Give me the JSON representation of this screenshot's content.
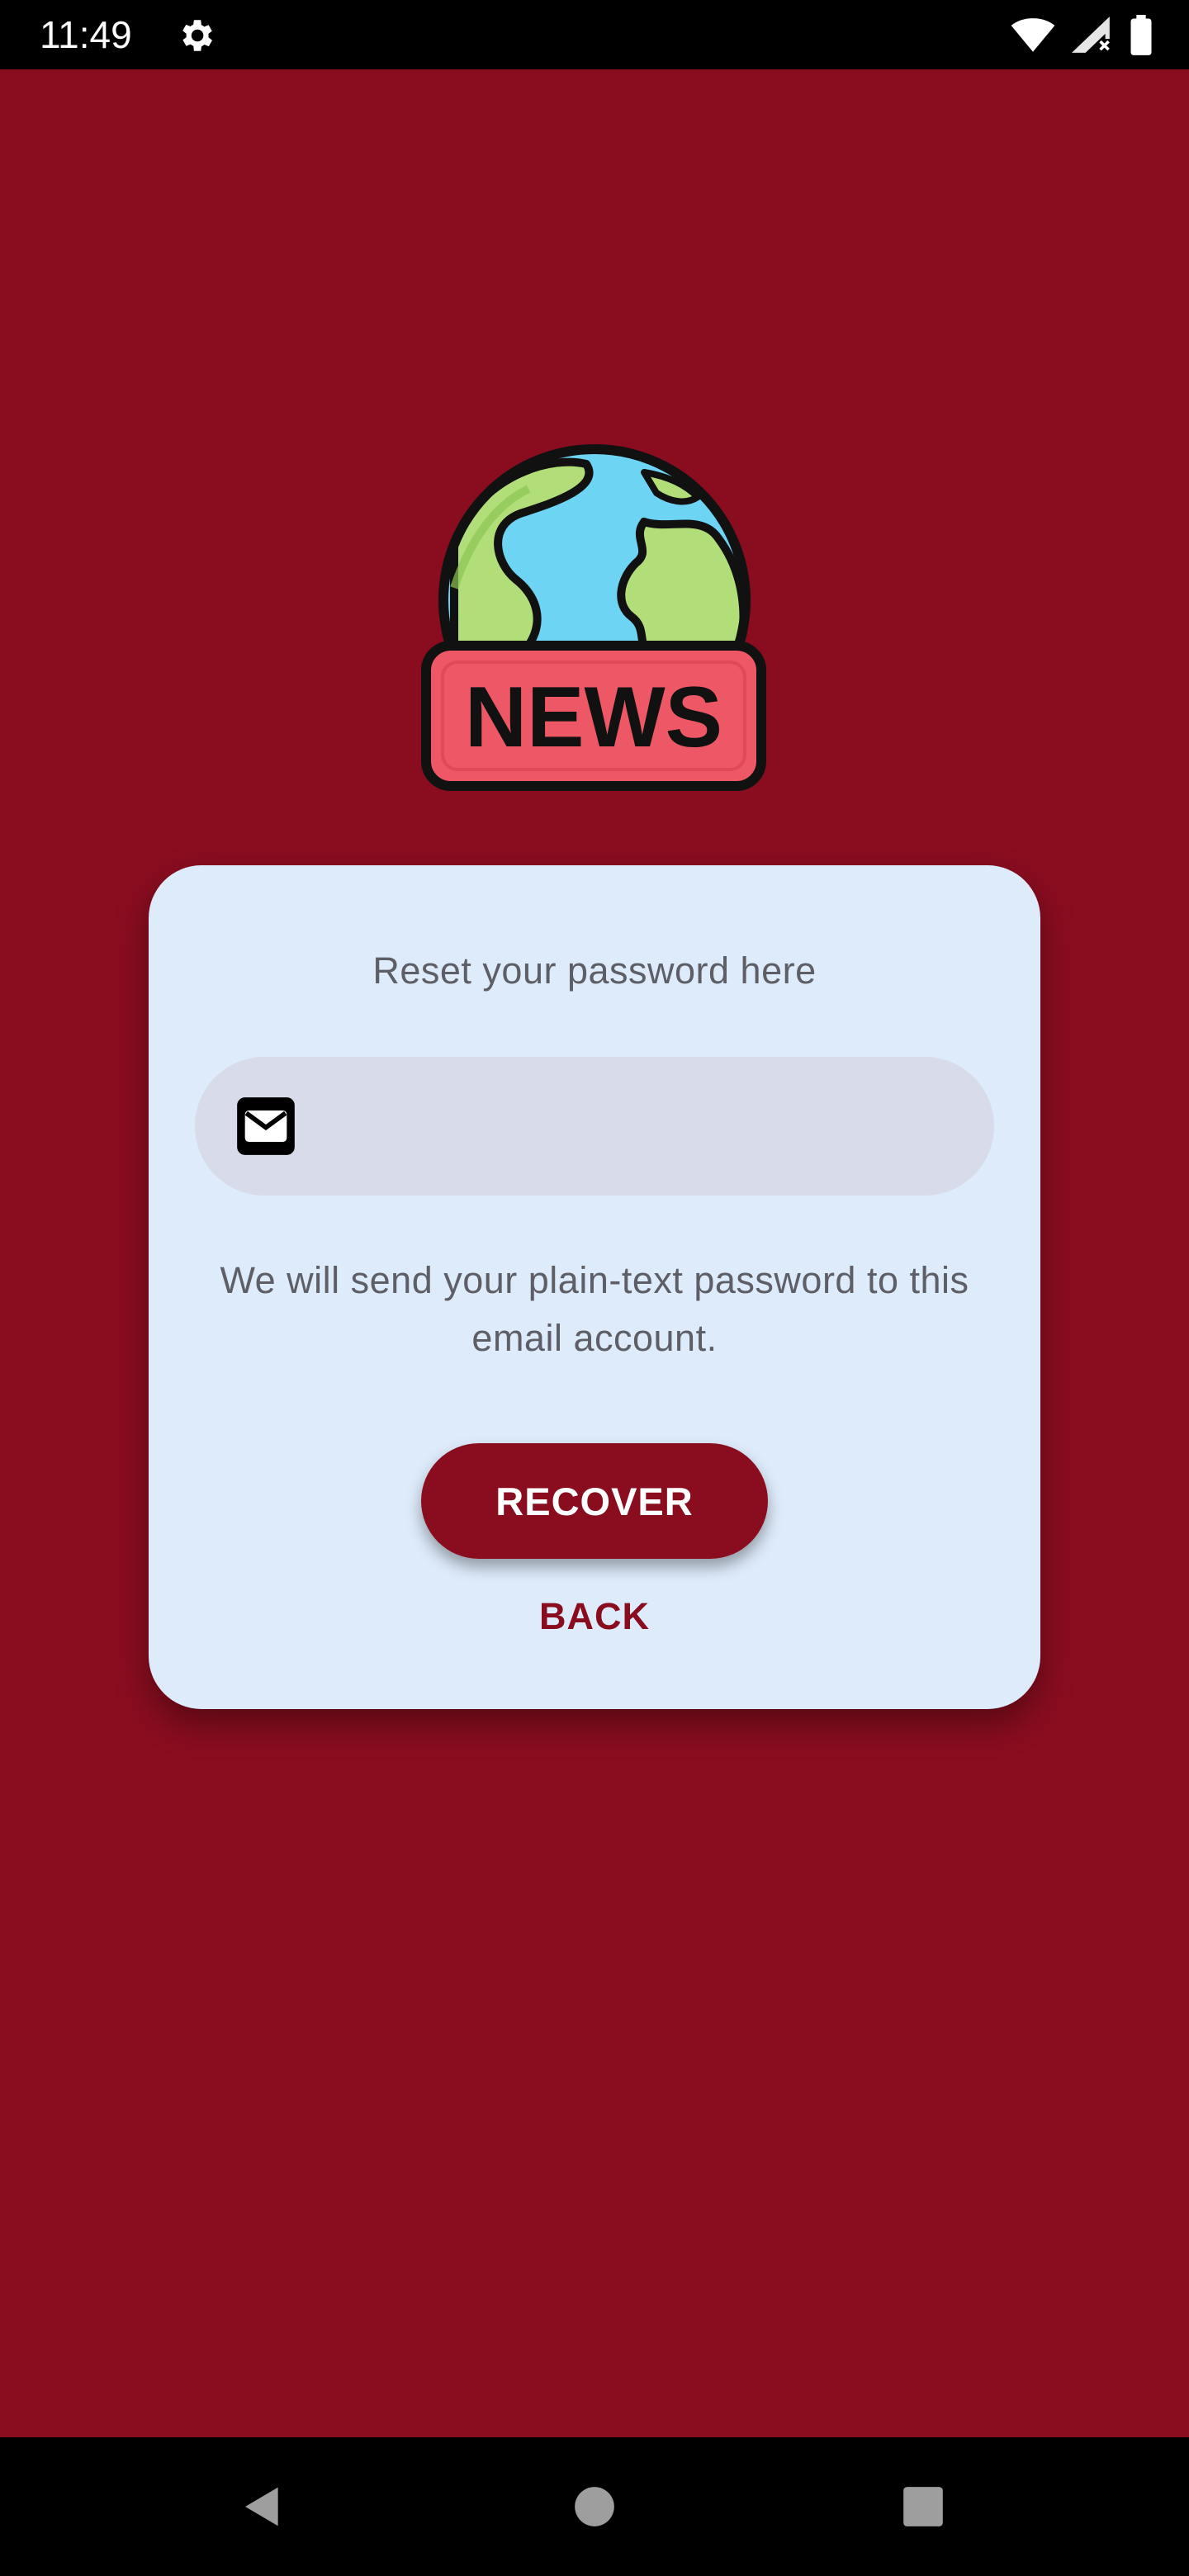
{
  "status_bar": {
    "time": "11:49",
    "icons": [
      "settings-gear-icon",
      "wifi-icon",
      "cellular-signal-icon",
      "battery-icon"
    ]
  },
  "logo": {
    "text": "NEWS",
    "icon": "globe-icon"
  },
  "reset_card": {
    "title": "Reset your password here",
    "email_field": {
      "icon": "email-icon",
      "value": "",
      "placeholder": ""
    },
    "note": "We will send your plain-text password to this email account.",
    "recover_label": "RECOVER",
    "back_label": "BACK"
  },
  "nav_bar": {
    "icons": [
      "back-triangle-icon",
      "home-circle-icon",
      "recents-square-icon"
    ]
  },
  "colors": {
    "background": "#890D1F",
    "card": "#DEEBFB",
    "field": "#D7DBEA",
    "accent": "#890D1F",
    "muted_text": "#5E5F66"
  }
}
